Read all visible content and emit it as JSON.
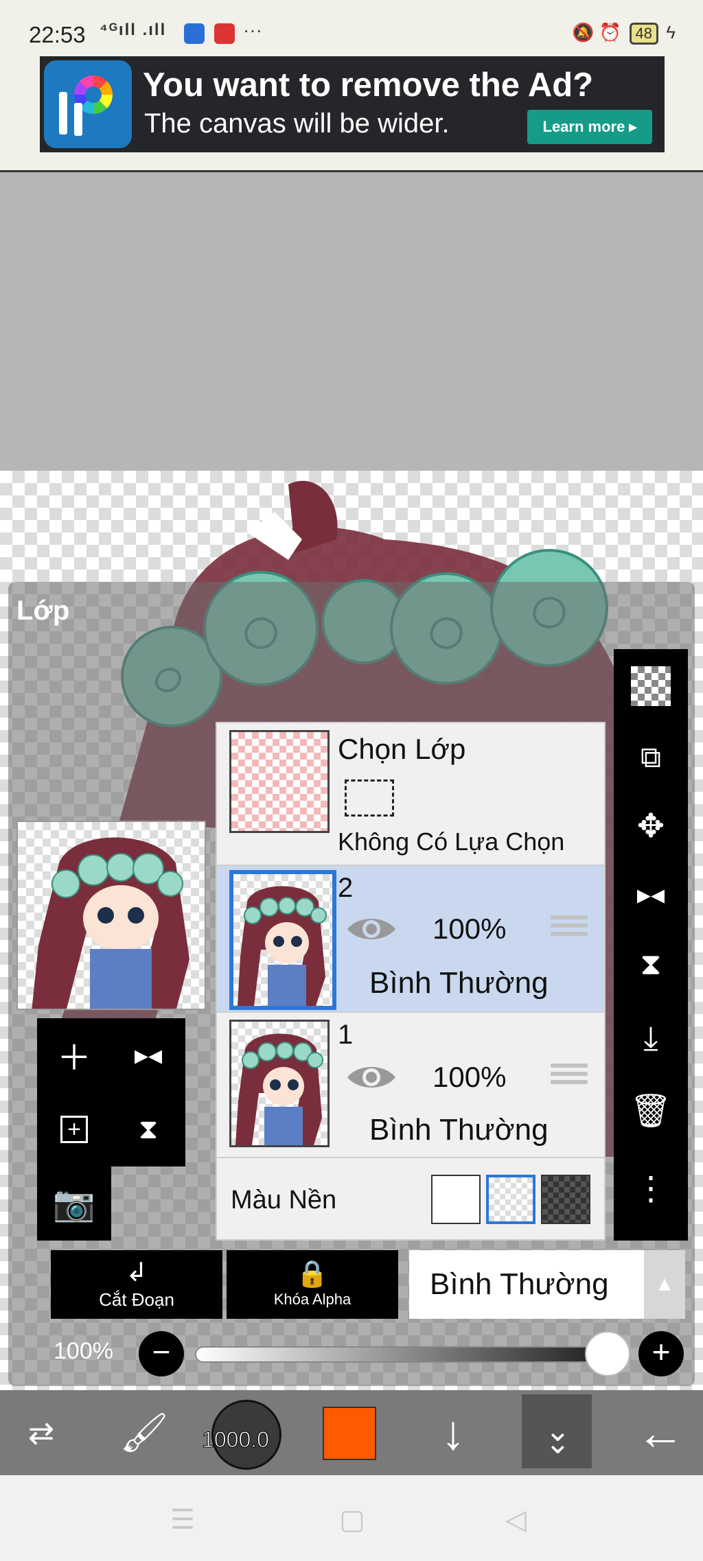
{
  "status_bar": {
    "time": "22:53",
    "network": "⁴ᴳıll .ıll",
    "more": "···",
    "battery": "48"
  },
  "ad": {
    "title": "You want to remove the Ad?",
    "subtitle": "The canvas will be wider.",
    "button": "Learn more ▸"
  },
  "layer_panel": {
    "title": "Lớp",
    "selection_row": {
      "title": "Chọn Lớp",
      "subtitle": "Không Có Lựa Chọn"
    },
    "layers": [
      {
        "number": "2",
        "opacity": "100%",
        "mode": "Bình Thường",
        "selected": true
      },
      {
        "number": "1",
        "opacity": "100%",
        "mode": "Bình Thường",
        "selected": false
      }
    ],
    "background_label": "Màu Nền",
    "background_colors": [
      "#ffffff",
      "transparent",
      "#3a3a3a"
    ]
  },
  "controls": {
    "clipping_label": "Cắt Đoạn",
    "alpha_lock_label": "Khóa Alpha",
    "blend_mode": "Bình Thường",
    "opacity_label": "100%",
    "opacity_value": 1.0
  },
  "bottom_bar": {
    "brush_size": "1000.0",
    "current_color": "#ff5a00"
  },
  "icons": {
    "left_tools": [
      "plus-icon",
      "flip-horizontal-icon",
      "add-layer-icon",
      "flip-vertical-icon",
      "camera-icon"
    ],
    "right_tools": [
      "checker-icon",
      "transform-icon",
      "move-icon",
      "flip-horizontal-icon",
      "flip-vertical-icon",
      "merge-down-icon",
      "trash-icon",
      "more-icon"
    ]
  }
}
